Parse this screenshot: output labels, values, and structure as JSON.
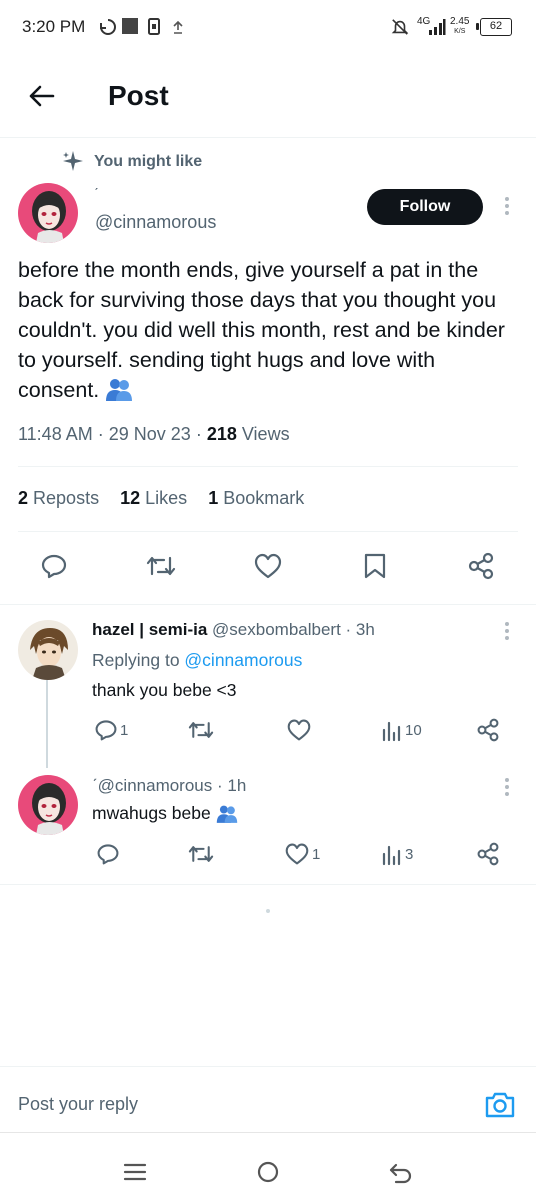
{
  "status_bar": {
    "time": "3:20 PM",
    "network": "4G",
    "speed": "2.45",
    "speed_unit": "K/S",
    "battery": "62"
  },
  "header": {
    "title": "Post"
  },
  "recommendation": {
    "label": "You might like"
  },
  "main_post": {
    "author_name": "ˊ",
    "author_handle": "@cinnamorous",
    "follow_label": "Follow",
    "text": "before the month ends, give yourself a pat in the back for surviving those days that you thought you couldn't. you did well this month, rest and be kinder to yourself. sending tight hugs and love with consent. ",
    "emoji": "people-hugging-emoji",
    "time": "11:48 AM",
    "date": "29 Nov 23",
    "views_count": "218",
    "views_label": "Views",
    "reposts_count": "2",
    "reposts_label": "Reposts",
    "likes_count": "12",
    "likes_label": "Likes",
    "bookmarks_count": "1",
    "bookmarks_label": "Bookmark",
    "actions": [
      "reply-icon",
      "repost-icon",
      "like-icon",
      "bookmark-icon",
      "share-icon"
    ]
  },
  "replies": [
    {
      "name": "hazel | semi-ia",
      "handle": "@sexbombalbert",
      "time": "· 3h",
      "replying_prefix": "Replying to ",
      "replying_handle": "@cinnamorous",
      "text": "thank you bebe <3",
      "reply_count": "1",
      "like_count": "",
      "views_count": "10"
    },
    {
      "name": "ˊ",
      "handle": "@cinnamorous",
      "time": "· 1h",
      "text": "mwahugs bebe ",
      "reply_count": "",
      "like_count": "1",
      "views_count": "3"
    }
  ],
  "compose": {
    "placeholder": "Post your reply"
  },
  "colors": {
    "text": "#0f1419",
    "secondary": "#536471",
    "accent": "#1d9bf0",
    "divider": "#eff3f4"
  }
}
